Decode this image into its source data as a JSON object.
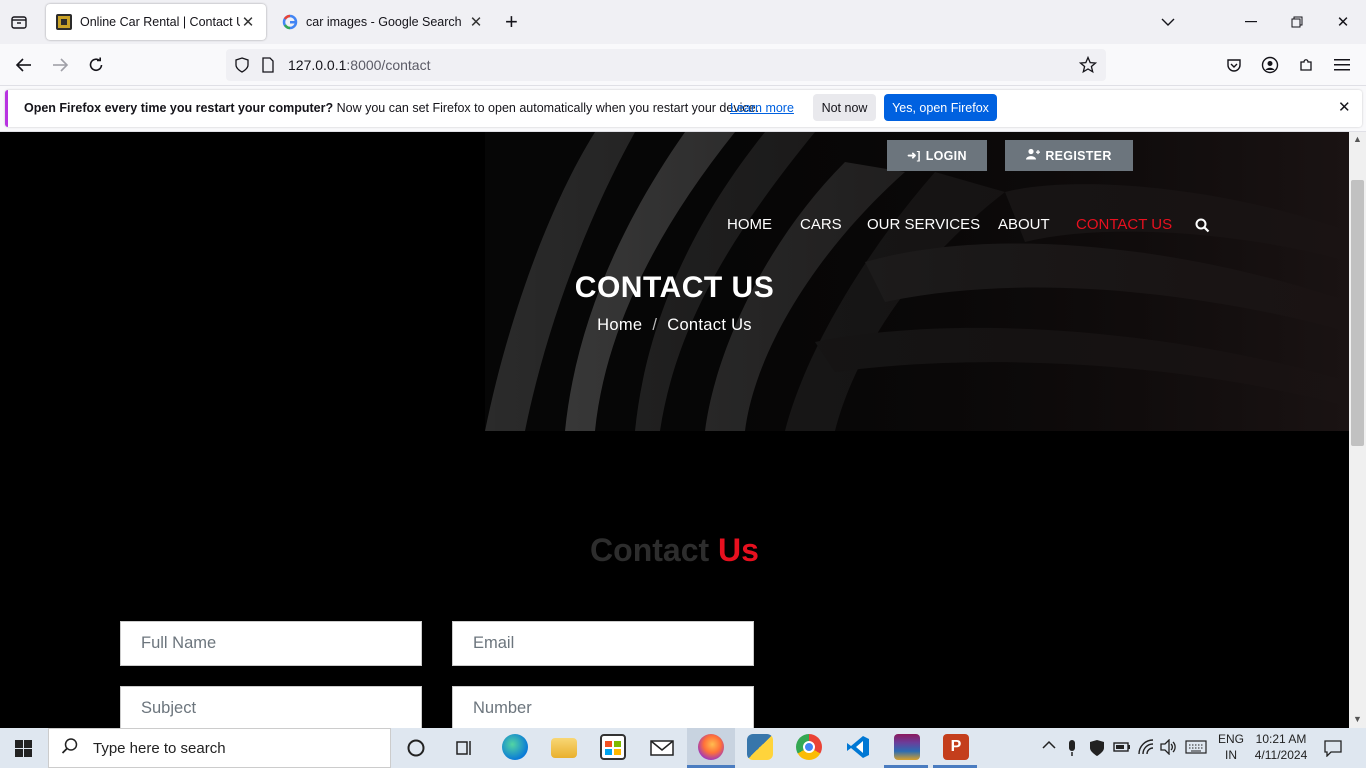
{
  "browser": {
    "tabs": [
      {
        "title": "Online Car Rental | Contact Us",
        "active": true
      },
      {
        "title": "car images - Google Search",
        "active": false
      }
    ],
    "url_host": "127.0.0.1",
    "url_path": ":8000/contact",
    "notification": {
      "bold": "Open Firefox every time you restart your computer?",
      "text": " Now you can set Firefox to open automatically when you restart your device.",
      "learn_more": "Learn more",
      "not_now": "Not now",
      "yes_open": "Yes, open Firefox"
    }
  },
  "site": {
    "login": "LOGIN",
    "register": "REGISTER",
    "menu": [
      "HOME",
      "CARS",
      "OUR SERVICES",
      "ABOUT",
      "CONTACT US"
    ],
    "active_menu": "CONTACT US",
    "hero_title": "CONTACT US",
    "breadcrumb": {
      "home": "Home",
      "separator": "/",
      "current": "Contact Us"
    },
    "section_title": {
      "part1": "Contact",
      "part2": "Us"
    },
    "form": {
      "full_name": "Full Name",
      "email": "Email",
      "subject": "Subject",
      "number": "Number"
    },
    "colors": {
      "accent": "#e8101f",
      "button": "#6c757d"
    }
  },
  "taskbar": {
    "search_placeholder": "Type here to search",
    "lang_top": "ENG",
    "lang_bottom": "IN",
    "time": "10:21 AM",
    "date": "4/11/2024"
  }
}
